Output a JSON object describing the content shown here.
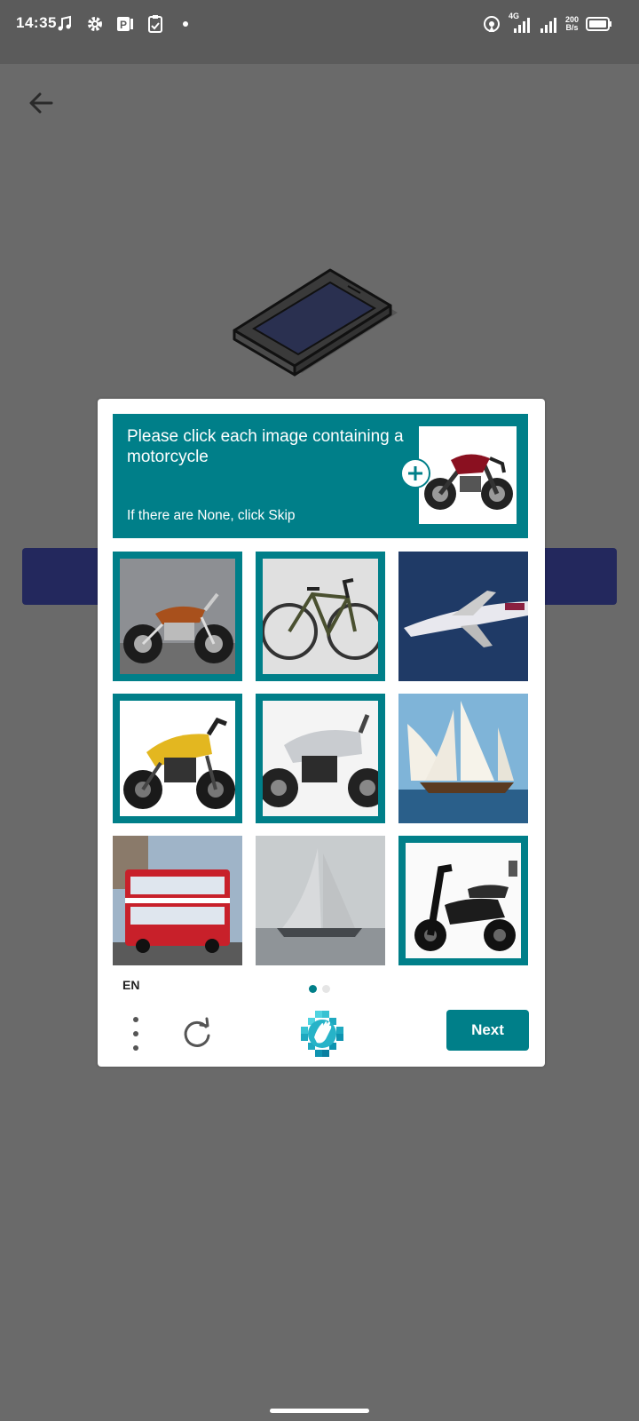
{
  "status_bar": {
    "time": "14:35",
    "network_type": "4G",
    "speed_value": "200",
    "speed_unit": "B/s",
    "left_icons": [
      "music-note-icon",
      "gear-icon",
      "parking-app-icon",
      "clipboard-icon",
      "dot-icon"
    ],
    "right_icons": [
      "hotspot-icon",
      "signal-icon",
      "signal-icon",
      "battery-icon"
    ]
  },
  "captcha": {
    "prompt_title": "Please click each image containing a motorcycle",
    "prompt_subtitle": "If there are None, click Skip",
    "example_image": "motorcycle",
    "tiles": [
      {
        "subject": "cruiser motorcycle",
        "selected": true
      },
      {
        "subject": "bicycle",
        "selected": true
      },
      {
        "subject": "airplane",
        "selected": false
      },
      {
        "subject": "yellow motorcycle",
        "selected": true
      },
      {
        "subject": "silver motorcycle",
        "selected": true
      },
      {
        "subject": "sailboat",
        "selected": false
      },
      {
        "subject": "double-decker bus",
        "selected": false
      },
      {
        "subject": "sailboat",
        "selected": false
      },
      {
        "subject": "scooter",
        "selected": true
      }
    ],
    "language": "EN",
    "page_dots": {
      "total": 2,
      "current": 1
    },
    "next_label": "Next"
  },
  "colors": {
    "accent": "#007f89",
    "overlay_bg": "#6a6a6a",
    "background_button": "#23285d"
  }
}
